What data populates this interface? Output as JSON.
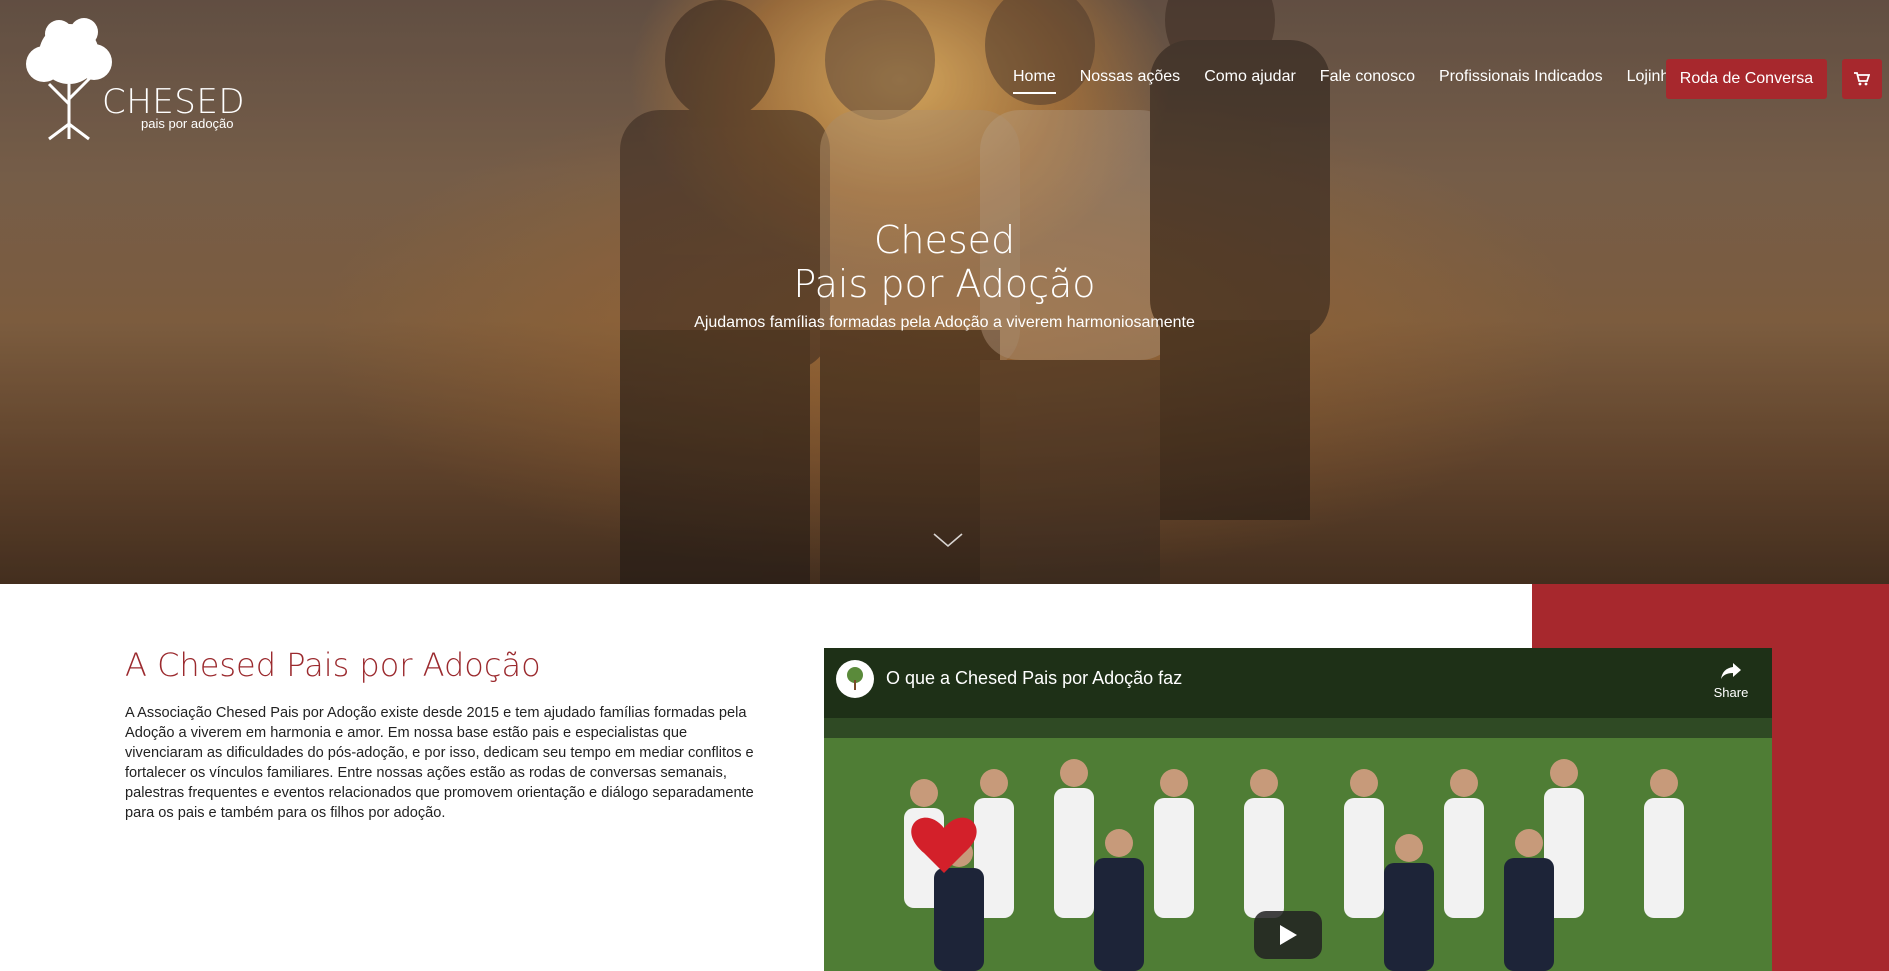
{
  "brand": {
    "name": "CHESED",
    "tagline": "pais por adoção"
  },
  "nav": {
    "items": [
      "Home",
      "Nossas ações",
      "Como ajudar",
      "Fale conosco",
      "Profissionais Indicados",
      "Lojinha"
    ],
    "active": "Home",
    "cta_label": "Roda de Conversa",
    "cart_icon": "cart-icon"
  },
  "hero": {
    "title_line1": "Chesed",
    "title_line2": "Pais por Adoção",
    "subtitle": "Ajudamos famílias formadas pela Adoção a viverem harmoniosamente",
    "scroll_icon": "chevron-down-icon"
  },
  "about": {
    "title": "A Chesed Pais por Adoção",
    "text": "A Associação Chesed Pais por Adoção existe desde 2015 e tem ajudado famílias formadas pela Adoção a viverem em harmonia e amor. Em nossa base estão pais e especialistas que vivenciaram as dificuldades do pós-adoção, e por isso, dedicam seu tempo em mediar conflitos e fortalecer os vínculos familiares. Entre nossas ações estão as rodas de conversas semanais, palestras frequentes e eventos relacionados que promovem orientação e diálogo separadamente para os pais e também para os filhos por adoção."
  },
  "video": {
    "title": "O que a Chesed Pais por Adoção faz",
    "share_label": "Share",
    "play_icon": "play-icon"
  },
  "colors": {
    "accent": "#a7282d",
    "title": "#9b2a2e"
  }
}
